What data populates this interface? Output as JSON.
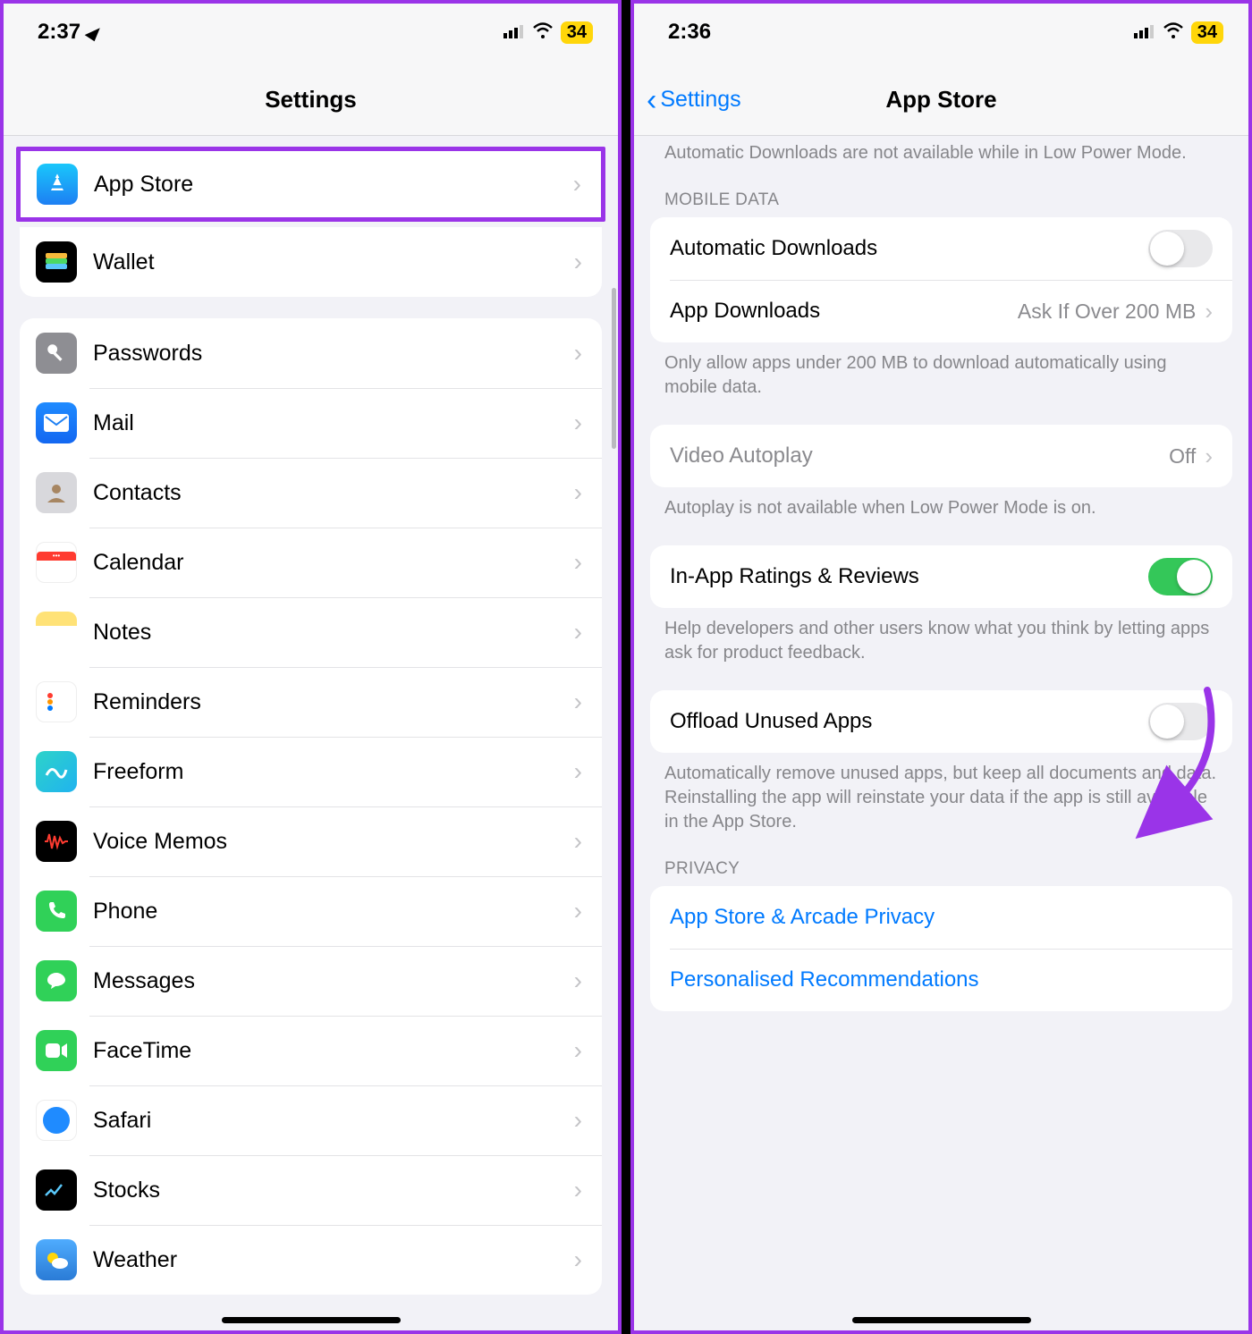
{
  "left": {
    "status": {
      "time": "2:37",
      "battery": "34"
    },
    "title": "Settings",
    "highlight": {
      "label": "App Store",
      "icon": "appstore-icon"
    },
    "group1": [
      {
        "label": "Wallet",
        "icon": "wallet-icon"
      }
    ],
    "group2": [
      {
        "label": "Passwords",
        "icon": "passwords-icon"
      },
      {
        "label": "Mail",
        "icon": "mail-icon"
      },
      {
        "label": "Contacts",
        "icon": "contacts-icon"
      },
      {
        "label": "Calendar",
        "icon": "calendar-icon"
      },
      {
        "label": "Notes",
        "icon": "notes-icon"
      },
      {
        "label": "Reminders",
        "icon": "reminders-icon"
      },
      {
        "label": "Freeform",
        "icon": "freeform-icon"
      },
      {
        "label": "Voice Memos",
        "icon": "voicememos-icon"
      },
      {
        "label": "Phone",
        "icon": "phone-icon"
      },
      {
        "label": "Messages",
        "icon": "messages-icon"
      },
      {
        "label": "FaceTime",
        "icon": "facetime-icon"
      },
      {
        "label": "Safari",
        "icon": "safari-icon"
      },
      {
        "label": "Stocks",
        "icon": "stocks-icon"
      },
      {
        "label": "Weather",
        "icon": "weather-icon"
      }
    ]
  },
  "right": {
    "status": {
      "time": "2:36",
      "battery": "34"
    },
    "back": "Settings",
    "title": "App Store",
    "top_note": "Automatic Downloads are not available while in Low Power Mode.",
    "section_mobile": "MOBILE DATA",
    "auto_dl": "Automatic Downloads",
    "app_dl": {
      "label": "App Downloads",
      "value": "Ask If Over 200 MB"
    },
    "mobile_note": "Only allow apps under 200 MB to download automatically using mobile data.",
    "video": {
      "label": "Video Autoplay",
      "value": "Off"
    },
    "video_note": "Autoplay is not available when Low Power Mode is on.",
    "ratings": "In-App Ratings & Reviews",
    "ratings_note": "Help developers and other users know what you think by letting apps ask for product feedback.",
    "offload": "Offload Unused Apps",
    "offload_note": "Automatically remove unused apps, but keep all documents and data. Reinstalling the app will reinstate your data if the app is still available in the App Store.",
    "section_privacy": "PRIVACY",
    "link1": "App Store & Arcade Privacy",
    "link2": "Personalised Recommendations"
  }
}
